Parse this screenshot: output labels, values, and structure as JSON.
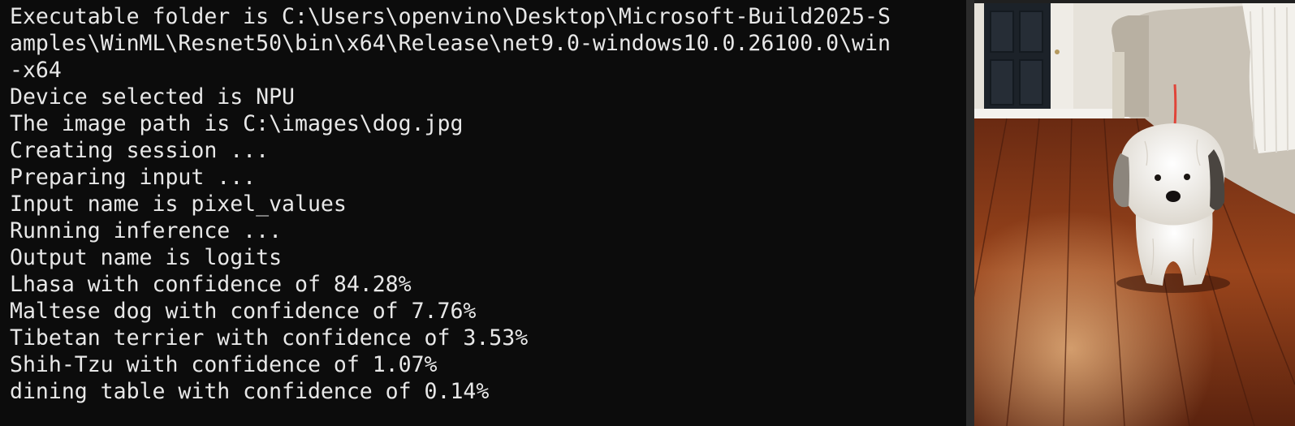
{
  "terminal": {
    "lines": [
      "Executable folder is C:\\Users\\openvino\\Desktop\\Microsoft-Build2025-S",
      "amples\\WinML\\Resnet50\\bin\\x64\\Release\\net9.0-windows10.0.26100.0\\win",
      "-x64",
      "Device selected is NPU",
      "The image path is C:\\images\\dog.jpg",
      "Creating session ...",
      "Preparing input ...",
      "Input name is pixel_values",
      "Running inference ...",
      "Output name is logits",
      "Lhasa with confidence of 84.28%",
      "Maltese dog with confidence of 7.76%",
      "Tibetan terrier with confidence of 3.53%",
      "Shih-Tzu with confidence of 1.07%",
      "dining table with confidence of 0.14%"
    ]
  },
  "photo": {
    "subject": "white-fluffy-dog-on-wood-floor",
    "colors": {
      "floor": "#8a3a1a",
      "wall": "#e6e2da",
      "door": "#1c2229",
      "sofa": "#c9c2b6",
      "dog": "#f2efe9",
      "dog_ears": "#4a4540",
      "leash": "#e0453a"
    }
  }
}
